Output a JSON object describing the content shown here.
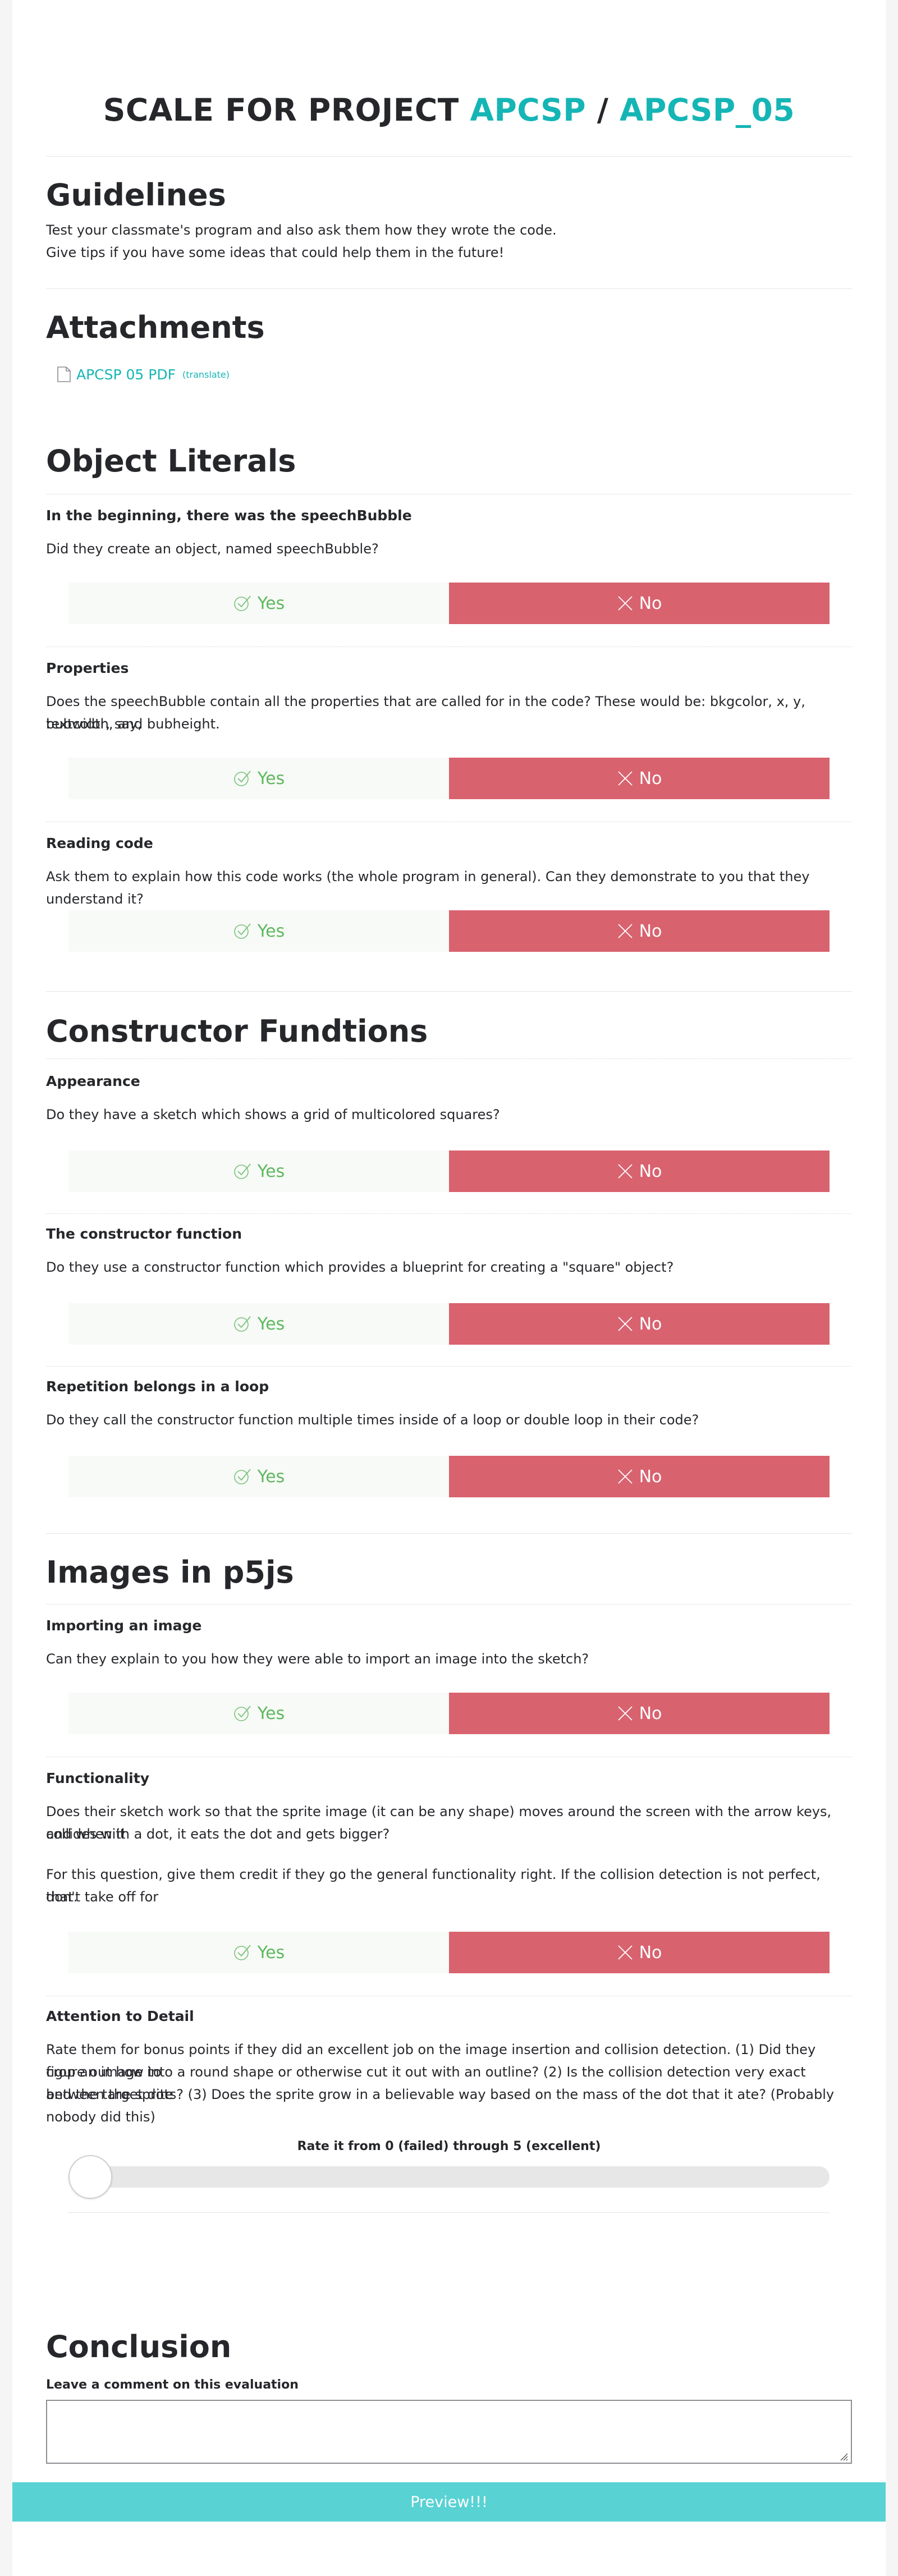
{
  "header": {
    "prefix": "SCALE FOR PROJECT",
    "course": "APCSP",
    "separator": "/",
    "project": "APCSP_05"
  },
  "guidelines": {
    "heading": "Guidelines",
    "line1": "Test your classmate's program and also ask them how they wrote the code.",
    "line2": "Give tips if you have some ideas that could help them in the future!"
  },
  "attachments": {
    "heading": "Attachments",
    "file_label": "APCSP 05 PDF",
    "translate_label": "(translate)",
    "icon": "document-icon"
  },
  "answer_labels": {
    "yes": "Yes",
    "no": "No"
  },
  "sections": [
    {
      "heading": "Object Literals",
      "questions": [
        {
          "title": "In the beginning, there was the speechBubble",
          "text": "Did they create an object, named speechBubble?"
        },
        {
          "title": "Properties",
          "text": "Does the speechBubble contain all the properties that are called for in the code? These would be: bkgcolor, x, y, textcolor, say,",
          "text2": "bubwidth, and bubheight."
        },
        {
          "title": "Reading code",
          "text": "Ask them to explain how this code works (the whole program in general). Can they demonstrate to you that they understand it?"
        }
      ]
    },
    {
      "heading": "Constructor Fundtions",
      "questions": [
        {
          "title": "Appearance",
          "text": "Do they have a sketch which shows a grid of multicolored squares?"
        },
        {
          "title": "The constructor function",
          "text": "Do they use a constructor function which provides a blueprint for creating a \"square\" object?"
        },
        {
          "title": "Repetition belongs in a loop",
          "text": "Do they call the constructor function multiple times inside of a loop or double loop in their code?"
        }
      ]
    },
    {
      "heading": "Images in p5js",
      "questions": [
        {
          "title": "Importing an image",
          "text": "Can they explain to you how they were able to import an image into the sketch?"
        },
        {
          "title": "Functionality",
          "text": "Does their sketch work so that the sprite image (it can be any shape) moves around the screen with the arrow keys, and when it",
          "text2": "collides with a dot, it eats the dot and gets bigger?",
          "text3": "For this question, give them credit if they go the general functionality right. If the collision detection is not perfect, don't take off for",
          "text4": "that."
        },
        {
          "title": "Attention to Detail",
          "text": "Rate them for bonus points if they did an excellent job on the image insertion and collision detection. (1) Did they figure out how to",
          "text2": "crop an image into a round shape or otherwise cut it out with an outline? (2) Is the collision detection very exact between the sprite",
          "text3": "and the target dots? (3) Does the sprite grow in a believable way based on the mass of the dot that it ate? (Probably nobody did this)",
          "rating_label": "Rate it from 0 (failed) through 5 (excellent)",
          "rating_value": 0
        }
      ]
    }
  ],
  "conclusion": {
    "heading": "Conclusion",
    "comment_label": "Leave a comment on this evaluation",
    "comment_value": ""
  },
  "preview_button": "Preview!!!",
  "colors": {
    "accent": "#16b5b5",
    "yes_bg": "#f7faf6",
    "yes_text": "#5fb85f",
    "no_bg": "#d9626f",
    "preview_bg": "#59d2d4"
  }
}
